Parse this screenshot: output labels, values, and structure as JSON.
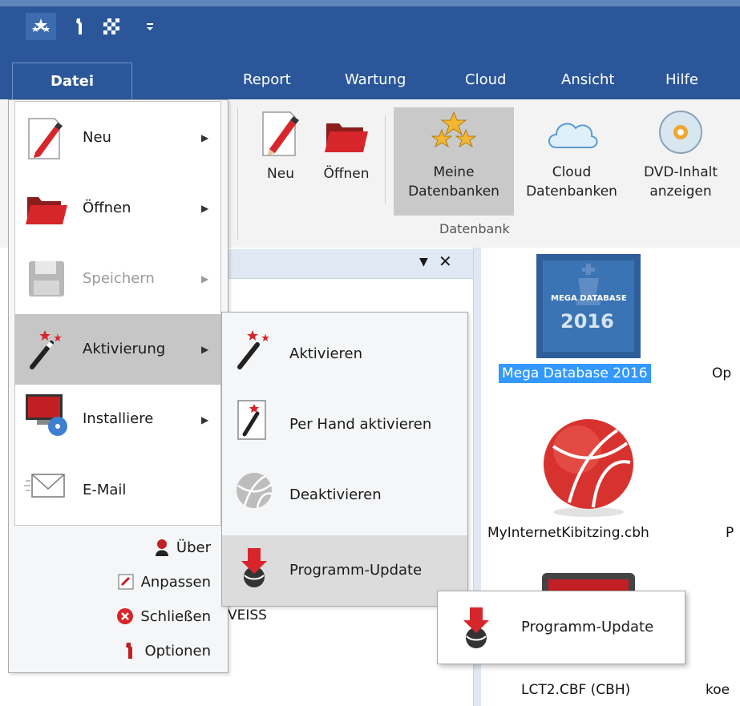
{
  "menubar": {
    "tabs": [
      {
        "id": "report",
        "label": "Report"
      },
      {
        "id": "wartung",
        "label": "Wartung"
      },
      {
        "id": "cloud",
        "label": "Cloud"
      },
      {
        "id": "ansicht",
        "label": "Ansicht"
      },
      {
        "id": "hilfe",
        "label": "Hilfe"
      }
    ]
  },
  "ribbon": {
    "buttons": [
      {
        "id": "neu",
        "label": "Neu"
      },
      {
        "id": "oeffnen",
        "label": "Öffnen"
      },
      {
        "id": "meine",
        "line1": "Meine",
        "line2": "Datenbanken"
      },
      {
        "id": "cloud",
        "line1": "Cloud",
        "line2": "Datenbanken"
      },
      {
        "id": "dvd",
        "line1": "DVD-Inhalt",
        "line2": "anzeigen"
      }
    ],
    "group_label": "Datenbank"
  },
  "file_menu": {
    "tab_label": "Datei",
    "items": [
      {
        "id": "neu",
        "label": "Neu",
        "icon": "pencil-document-icon",
        "submenu": true
      },
      {
        "id": "oeffnen",
        "label": "Öffnen",
        "icon": "folder-icon",
        "submenu": true
      },
      {
        "id": "speichern",
        "label": "Speichern",
        "icon": "floppy-disk-icon",
        "submenu": true,
        "disabled": true
      },
      {
        "id": "aktivierung",
        "label": "Aktivierung",
        "icon": "magic-wand-icon",
        "submenu": true,
        "active": true
      },
      {
        "id": "installiere",
        "label": "Installiere",
        "icon": "monitor-dvd-icon",
        "submenu": true
      },
      {
        "id": "email",
        "label": "E-Mail",
        "icon": "envelope-icon",
        "submenu": false
      }
    ],
    "bottom": [
      {
        "id": "ueber",
        "label": "Über",
        "icon": "user-icon"
      },
      {
        "id": "anpassen",
        "label": "Anpassen",
        "icon": "customize-icon"
      },
      {
        "id": "schliessen",
        "label": "Schließen",
        "icon": "close-circle-icon"
      },
      {
        "id": "optionen",
        "label": "Optionen",
        "icon": "wrench-icon"
      }
    ]
  },
  "submenu": {
    "items": [
      {
        "id": "aktivieren",
        "label": "Aktivieren",
        "icon": "magic-wand-icon"
      },
      {
        "id": "per_hand",
        "label": "Per Hand aktivieren",
        "icon": "wand-card-icon"
      },
      {
        "id": "deaktivieren",
        "label": "Deaktivieren",
        "icon": "globe-grey-icon"
      },
      {
        "id": "update",
        "label": "Programm-Update",
        "icon": "update-arrow-icon"
      }
    ]
  },
  "tooltip": {
    "label": "Programm-Update"
  },
  "databases": {
    "mega": {
      "label": "Mega Database 2016",
      "logo_top": "MEGA DATABASE",
      "logo_year": "2016"
    },
    "kibitz": {
      "label": "MyInternetKibitzing.cbh"
    },
    "lct": {
      "label": "LCT2.CBF (CBH)"
    },
    "partial_1": "Op",
    "partial_2": "P",
    "partial_3": "koe"
  },
  "left_pane": {
    "partial_text": "VEISS"
  },
  "colors": {
    "accent": "#2b579a",
    "selection": "#3399ff"
  }
}
